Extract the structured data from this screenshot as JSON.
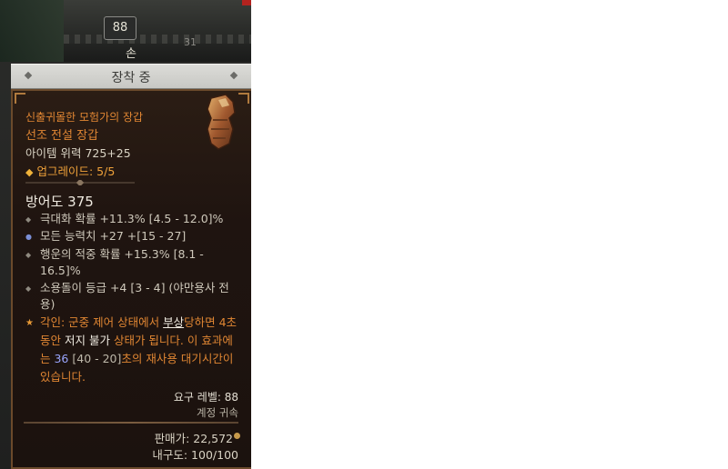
{
  "header": {
    "level": "88",
    "slot_label": "손",
    "faded_number": "31",
    "equipped_label": "장착 중"
  },
  "item": {
    "name_prefix": "신출귀몰한 모험가의 장갑",
    "name": "선조 전설 장갑",
    "item_power": "아이템 위력 725+25",
    "upgrade": "업그레이드: 5/5",
    "armor": "방어도 375",
    "icon": "gauntlet-icon"
  },
  "affixes": [
    {
      "text": "극대화 확률 +11.3% [4.5 - 12.0]%",
      "bullet": "diamond"
    },
    {
      "text": "모든 능력치 +27 +[15 - 27]",
      "bullet": "blue-circle"
    },
    {
      "text": "행운의 적중 확률 +15.3% [8.1 - 16.5]%",
      "bullet": "diamond"
    },
    {
      "text": "소용돌이 등급 +4 [3 - 4] (야만용사 전용)",
      "bullet": "diamond"
    }
  ],
  "aspect": {
    "part1": "각인: 군중 제어 상태에서 ",
    "part2": "부상",
    "part3": "당하면 4초 동안 ",
    "part4": "저지 불가",
    "part5": " 상태가 됩니다. 이 효과에는 ",
    "part6": "36",
    "part7": " [40 - 20]",
    "part8": "초의 재사용 대기시간이 있습니다."
  },
  "requirements": {
    "level_req": "요구 레벨: 88",
    "bind": "계정 귀속",
    "sell_price": "판매가: 22,572",
    "durability": "내구도: 100/100"
  },
  "colors": {
    "legendary_orange": "#e08633",
    "frame_brown": "#6b4a2b"
  }
}
